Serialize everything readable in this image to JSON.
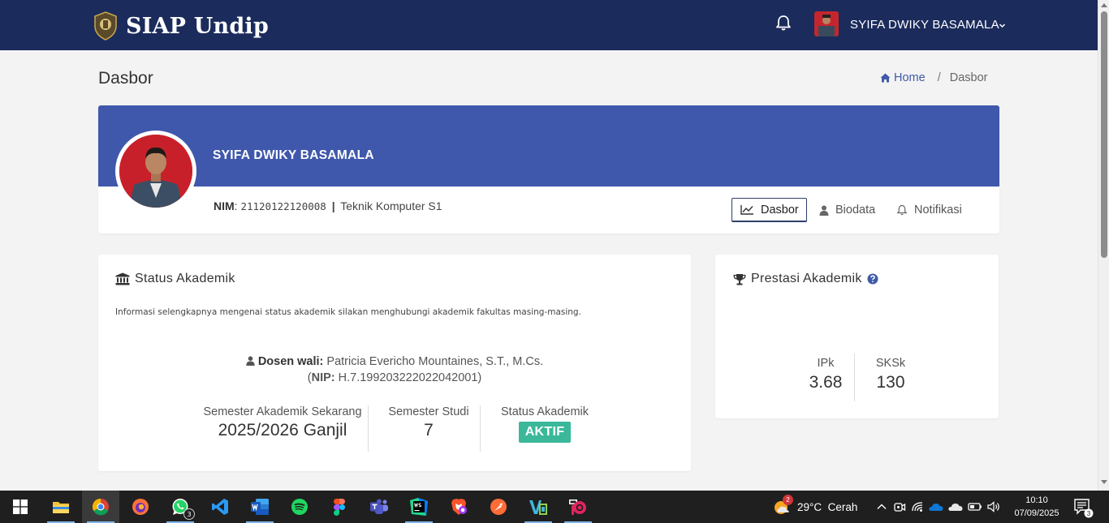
{
  "app": {
    "title": "SIAP Undip"
  },
  "nav": {
    "user_name": "SYIFA DWIKY BASAMALA"
  },
  "page": {
    "title": "Dasbor",
    "breadcrumb": {
      "home": "Home",
      "separator": "/",
      "current": "Dasbor"
    }
  },
  "profile": {
    "name": "SYIFA DWIKY BASAMALA",
    "nim_label": "NIM",
    "nim_value": "21120122120008",
    "pipe": "|",
    "program": "Teknik Komputer S1",
    "tabs": [
      {
        "label": "Dasbor",
        "icon": "line-chart-icon",
        "active": true
      },
      {
        "label": "Biodata",
        "icon": "user-icon",
        "active": false
      },
      {
        "label": "Notifikasi",
        "icon": "bell-icon",
        "active": false
      }
    ]
  },
  "status": {
    "title": "Status Akademik",
    "info": "Informasi selengkapnya mengenai status akademik silakan menghubungi akademik fakultas masing-masing.",
    "dosen_label": "Dosen wali:",
    "dosen_name": "Patricia Evericho Mountaines, S.T., M.Cs.",
    "nip_label": "NIP:",
    "nip_value": "H.7.199203222022042001",
    "semester_label": "Semester Akademik Sekarang",
    "semester_value": "2025/2026 Ganjil",
    "studi_label": "Semester Studi",
    "studi_value": "7",
    "status_label": "Status Akademik",
    "status_value": "AKTIF"
  },
  "prestasi": {
    "title": "Prestasi Akademik",
    "ipk_label": "IPk",
    "ipk_value": "3.68",
    "sksk_label": "SKSk",
    "sksk_value": "130"
  },
  "taskbar": {
    "apps": [
      "File Explorer",
      "Chrome",
      "Firefox",
      "WhatsApp",
      "VS Code",
      "Word",
      "Spotify",
      "Figma",
      "Teams",
      "WebStorm",
      "Brave",
      "Postman",
      "Vivado",
      "Vocal Remover"
    ],
    "whatsapp_badge": "3",
    "weather_badge": "2",
    "weather": "29°C  Cerah",
    "time": "10:10",
    "date": "07/09/2025",
    "notif_count": "3"
  },
  "colors": {
    "navbar": "#1b2b5c",
    "banner": "#3f58ab",
    "accent_link": "#3f5aa8",
    "status_badge": "#3bb89a"
  }
}
